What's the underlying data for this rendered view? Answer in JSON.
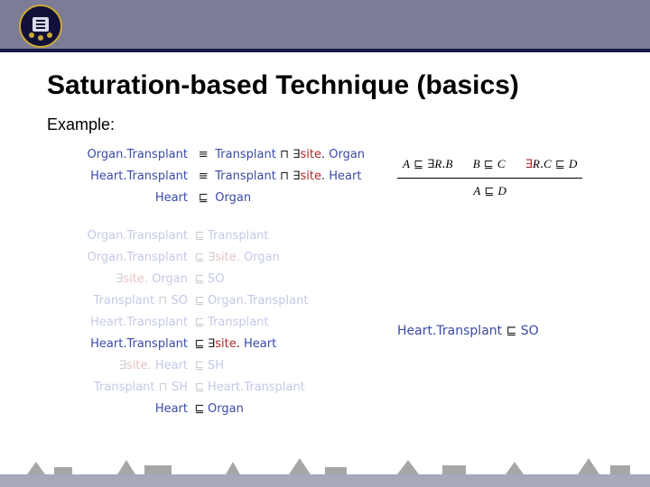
{
  "header": {
    "title": "Saturation-based Technique (basics)",
    "example_label": "Example:"
  },
  "colors": {
    "topbar": "#7c7c97",
    "topbar_border": "#1a1a44",
    "term": "#3a4aa8",
    "site": "#b02a2a"
  },
  "symbols": {
    "equiv": "≡",
    "sub": "⊑",
    "sqcap": "⊓",
    "exists": "∃",
    "dot": "."
  },
  "axioms_top": [
    {
      "lhs": "Organ.Transplant",
      "rel": "equiv",
      "rhs_parts": [
        "Transplant",
        "sqcap",
        "exists",
        "site",
        ".",
        "Organ"
      ]
    },
    {
      "lhs": "Heart.Transplant",
      "rel": "equiv",
      "rhs_parts": [
        "Transplant",
        "sqcap",
        "exists",
        "site",
        ".",
        "Heart"
      ]
    },
    {
      "lhs": "Heart",
      "rel": "sub",
      "rhs_parts": [
        "Organ"
      ]
    }
  ],
  "derivations": [
    {
      "lhs_parts": [
        "Organ.Transplant"
      ],
      "rel": "sub",
      "rhs_parts": [
        "Transplant"
      ],
      "faint": true
    },
    {
      "lhs_parts": [
        "Organ.Transplant"
      ],
      "rel": "sub",
      "rhs_parts": [
        "exists",
        "site",
        ".",
        "Organ"
      ],
      "faint": true
    },
    {
      "lhs_parts": [
        "exists",
        "site",
        ".",
        "Organ"
      ],
      "rel": "sub",
      "rhs_parts": [
        "SO"
      ],
      "faint": true
    },
    {
      "lhs_parts": [
        "Transplant",
        "sqcap",
        "SO"
      ],
      "rel": "sub",
      "rhs_parts": [
        "Organ.Transplant"
      ],
      "faint": true
    },
    {
      "lhs_parts": [
        "Heart.Transplant"
      ],
      "rel": "sub",
      "rhs_parts": [
        "Transplant"
      ],
      "faint": true
    },
    {
      "lhs_parts": [
        "Heart.Transplant"
      ],
      "rel": "sub",
      "rhs_parts": [
        "exists",
        "site",
        ".",
        "Heart"
      ],
      "faint": false
    },
    {
      "lhs_parts": [
        "exists",
        "site",
        ".",
        "Heart"
      ],
      "rel": "sub",
      "rhs_parts": [
        "SH"
      ],
      "faint": true
    },
    {
      "lhs_parts": [
        "Transplant",
        "sqcap",
        "SH"
      ],
      "rel": "sub",
      "rhs_parts": [
        "Heart.Transplant"
      ],
      "faint": true
    },
    {
      "lhs_parts": [
        "Heart"
      ],
      "rel": "sub",
      "rhs_parts": [
        "Organ"
      ],
      "faint": false
    }
  ],
  "rule": {
    "premise1": {
      "A": "A",
      "rel": "sub",
      "exists": "∃",
      "R": "R",
      "B": "B"
    },
    "premise2": {
      "B": "B",
      "rel": "sub",
      "C": "C"
    },
    "premise3": {
      "exists": "∃",
      "R": "R",
      "C": "C",
      "rel": "sub",
      "D": "D"
    },
    "conclusion": {
      "A": "A",
      "rel": "sub",
      "D": "D"
    }
  },
  "right_highlight": {
    "lhs": "Heart.Transplant",
    "rel": "sub",
    "rhs": "SO"
  }
}
